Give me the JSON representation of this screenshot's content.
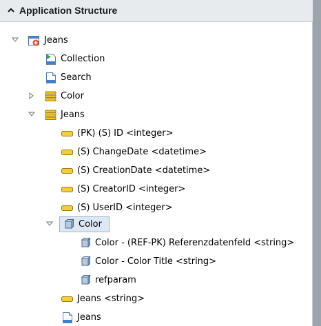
{
  "header": {
    "title": "Application Structure"
  },
  "tree": [
    {
      "label": "Jeans"
    },
    {
      "label": "Collection"
    },
    {
      "label": "Search"
    },
    {
      "label": "Color"
    },
    {
      "label": "Jeans"
    },
    {
      "label": "(PK) (S) ID <integer>"
    },
    {
      "label": "(S) ChangeDate <datetime>"
    },
    {
      "label": "(S) CreationDate <datetime>"
    },
    {
      "label": "(S) CreatorID <integer>"
    },
    {
      "label": "(S) UserID <integer>"
    },
    {
      "label": "Color"
    },
    {
      "label": "Color - (REF-PK) Referenzdatenfeld <string>"
    },
    {
      "label": "Color - Color Title <string>"
    },
    {
      "label": "refparam"
    },
    {
      "label": "Jeans <string>"
    },
    {
      "label": "Jeans"
    }
  ]
}
